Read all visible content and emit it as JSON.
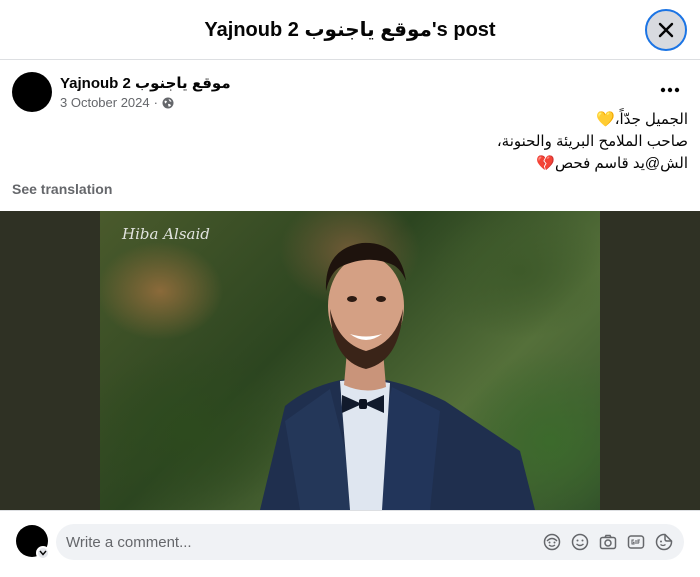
{
  "header": {
    "title": "Yajnoub 2 موقع ياجنوب's post"
  },
  "post": {
    "author": "Yajnoub 2 موقع ياجنوب",
    "date": "3 October 2024",
    "separator": "·",
    "text_lines": [
      "الجميل جدّاً،💛",
      "صاحب الملامح البريئة والحنونة،",
      "الش@يد قاسم فحص💔"
    ],
    "see_translation": "See translation"
  },
  "photo": {
    "watermark": "Hiba Alsaid"
  },
  "comment": {
    "placeholder": "Write a comment..."
  }
}
